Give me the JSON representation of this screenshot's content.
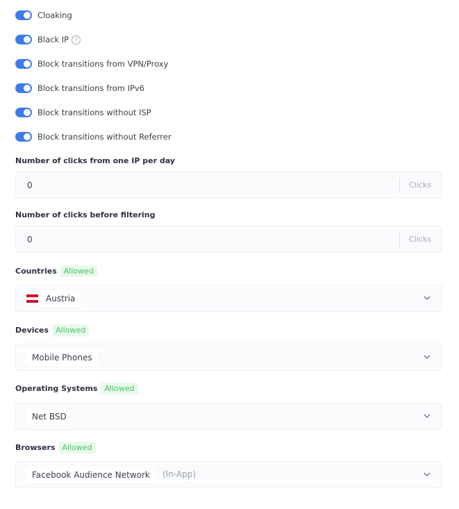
{
  "toggles": [
    {
      "label": "Cloaking",
      "enabled": true
    },
    {
      "label": "Black IP",
      "enabled": true,
      "help_icon": "question-circle-icon"
    },
    {
      "label": "Block transitions from VPN/Proxy",
      "enabled": true
    },
    {
      "label": "Block transitions from IPv6",
      "enabled": true
    },
    {
      "label": "Block transitions without ISP",
      "enabled": true
    },
    {
      "label": "Block transitions without Referrer",
      "enabled": true
    }
  ],
  "clicks_per_ip": {
    "label": "Number of clicks from one IP per day",
    "value": "0",
    "unit": "Clicks"
  },
  "clicks_before_filter": {
    "label": "Number of clicks before filtering",
    "value": "0",
    "unit": "Clicks"
  },
  "countries": {
    "label": "Countries",
    "mode": "Allowed",
    "selected": [
      {
        "name": "Austria",
        "flag": "austria-flag-icon"
      }
    ]
  },
  "devices": {
    "label": "Devices",
    "mode": "Allowed",
    "selected": [
      {
        "name": "Mobile Phones"
      }
    ]
  },
  "operating_systems": {
    "label": "Operating Systems",
    "mode": "Allowed",
    "selected": [
      {
        "name": "Net BSD"
      }
    ]
  },
  "browsers": {
    "label": "Browsers",
    "mode": "Allowed",
    "selected": [
      {
        "name": "Facebook Audience Network",
        "suffix": "(In-App)"
      }
    ]
  },
  "colors": {
    "toggle_on": "#3f7be8",
    "badge_text": "#46c65e",
    "badge_bg": "#e9f8ec",
    "field_bg": "#fafbfc"
  },
  "icons": {
    "dropdown": "chevron-down-icon",
    "help": "question-circle-icon"
  }
}
